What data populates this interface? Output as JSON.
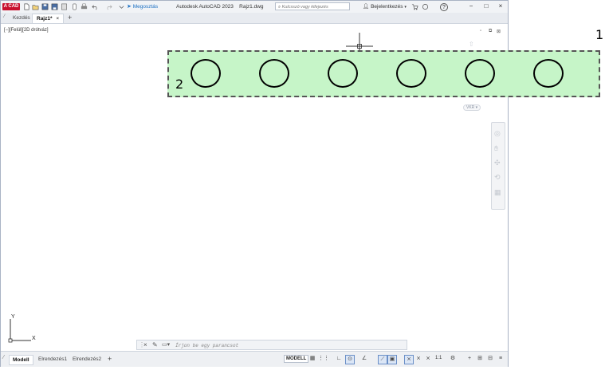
{
  "titlebar": {
    "logo_text": "A CAD",
    "share_label": "Megosztás",
    "app_title": "Autodesk AutoCAD 2023",
    "file_name": "Rajz1.dwg",
    "search_placeholder": "Kulcsszó vagy kifejezés",
    "login_label": "Bejelentkezés",
    "help_icon": "?"
  },
  "tabs": {
    "home_label": "Kezdés",
    "doc_label": "Rajz1*",
    "close_glyph": "×",
    "new_glyph": "+"
  },
  "viewport": {
    "view_control": "[−][Felül][2D drótváz]",
    "vkr_label": "VKR"
  },
  "annotations": {
    "label_1": "1",
    "label_2": "2"
  },
  "ucs": {
    "y_label": "Y",
    "x_label": "X"
  },
  "command_line": {
    "placeholder": "Írjon be egy parancsot"
  },
  "status": {
    "layout_tabs": [
      "Modell",
      "Elrendezés1",
      "Elrendezés2"
    ],
    "add_tab": "+",
    "model_button": "MODELL",
    "scale": "1:1"
  },
  "colors": {
    "selection_fill": "#c6f5c8",
    "accent": "#1b6fc2",
    "logo": "#c8102e"
  }
}
